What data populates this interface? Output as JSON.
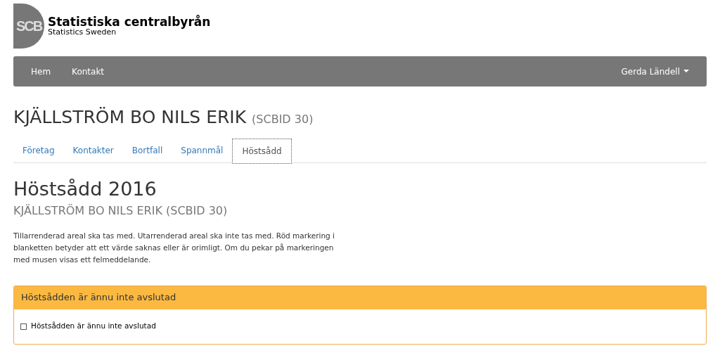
{
  "logo": {
    "mark": "SCB",
    "title": "Statistiska centralbyrån",
    "subtitle": "Statistics Sweden"
  },
  "navbar": {
    "links": [
      "Hem",
      "Kontakt"
    ],
    "user": "Gerda Ländell"
  },
  "page_title": {
    "name": "KJÄLLSTRÖM BO NILS ERIK",
    "id": "(SCBID 30)"
  },
  "tabs": [
    {
      "label": "Företag",
      "selected": false
    },
    {
      "label": "Kontakter",
      "selected": false
    },
    {
      "label": "Bortfall",
      "selected": false
    },
    {
      "label": "Spannmål",
      "selected": false
    },
    {
      "label": "Höstsådd",
      "selected": true
    }
  ],
  "section": {
    "title": "Höstsådd 2016",
    "subtitle": "KJÄLLSTRÖM BO NILS ERIK (SCBID 30)",
    "text": "Tillarrenderad areal ska tas med. Utarrenderad areal ska inte tas med. Röd markering i blanketten betyder att ett värde saknas eller är orimligt. Om du pekar på markeringen med musen visas ett felmeddelande."
  },
  "panel": {
    "title": "Höstsådden är ännu inte avslutad",
    "checkbox": {
      "label": "Höstsådden är ännu inte avslutad",
      "checked": false
    }
  }
}
